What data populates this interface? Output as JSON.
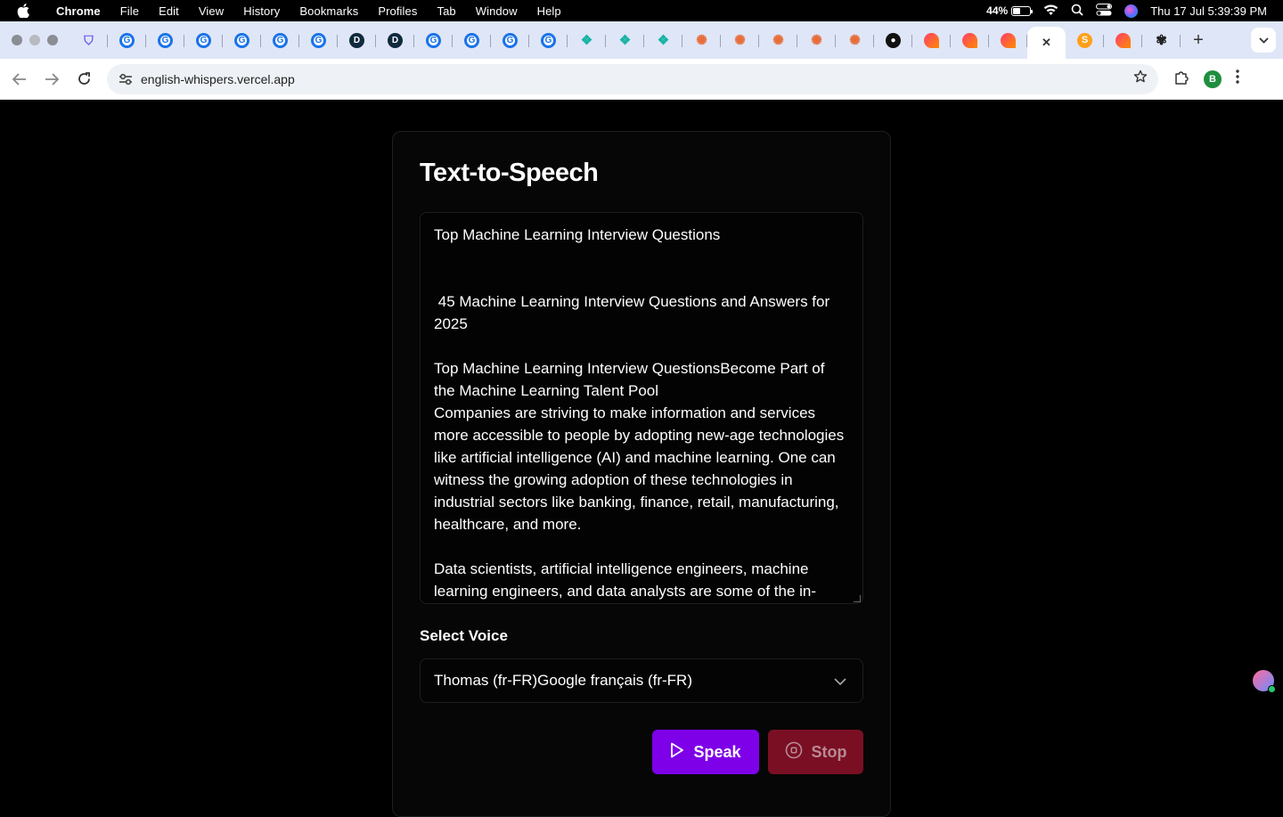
{
  "menubar": {
    "app": "Chrome",
    "items": [
      "File",
      "Edit",
      "View",
      "History",
      "Bookmarks",
      "Profiles",
      "Tab",
      "Window",
      "Help"
    ],
    "battery": "44%",
    "battery_level": 0.44,
    "datetime": "Thu 17 Jul  5:39:39 PM"
  },
  "tabs": [
    {
      "icon": "shield-icon",
      "kind": "sh",
      "glyph": "⛉"
    },
    {
      "icon": "google-icon",
      "kind": "g",
      "glyph": "G"
    },
    {
      "icon": "google-icon",
      "kind": "g",
      "glyph": "G"
    },
    {
      "icon": "google-icon",
      "kind": "g",
      "glyph": "G"
    },
    {
      "icon": "google-icon",
      "kind": "g",
      "glyph": "G"
    },
    {
      "icon": "google-icon",
      "kind": "g",
      "glyph": "G"
    },
    {
      "icon": "google-icon",
      "kind": "g",
      "glyph": "G"
    },
    {
      "icon": "d-icon",
      "kind": "d",
      "glyph": "D"
    },
    {
      "icon": "d-icon",
      "kind": "d",
      "glyph": "D"
    },
    {
      "icon": "google-icon",
      "kind": "g",
      "glyph": "G"
    },
    {
      "icon": "google-icon",
      "kind": "g",
      "glyph": "G"
    },
    {
      "icon": "google-icon",
      "kind": "g",
      "glyph": "G"
    },
    {
      "icon": "google-icon",
      "kind": "g",
      "glyph": "G"
    },
    {
      "icon": "teal-knot-icon",
      "kind": "t",
      "glyph": "❖"
    },
    {
      "icon": "teal-knot-icon",
      "kind": "t",
      "glyph": "❖"
    },
    {
      "icon": "teal-knot-icon",
      "kind": "t",
      "glyph": "❖"
    },
    {
      "icon": "claude-icon",
      "kind": "c",
      "glyph": "✺"
    },
    {
      "icon": "claude-icon",
      "kind": "c",
      "glyph": "✺"
    },
    {
      "icon": "claude-icon",
      "kind": "c",
      "glyph": "✺"
    },
    {
      "icon": "claude-icon",
      "kind": "c",
      "glyph": "✺"
    },
    {
      "icon": "claude-icon",
      "kind": "c",
      "glyph": "✺"
    },
    {
      "icon": "github-icon",
      "kind": "gh",
      "glyph": "●"
    },
    {
      "icon": "lovable-icon",
      "kind": "p",
      "glyph": ""
    },
    {
      "icon": "lovable-icon",
      "kind": "p",
      "glyph": ""
    },
    {
      "icon": "lovable-icon",
      "kind": "p",
      "glyph": ""
    },
    {
      "icon": "close-icon",
      "kind": "active",
      "glyph": "✕"
    },
    {
      "icon": "s-icon",
      "kind": "s",
      "glyph": "S"
    },
    {
      "icon": "lovable-icon",
      "kind": "p",
      "glyph": ""
    },
    {
      "icon": "openai-icon",
      "kind": "o",
      "glyph": "✾"
    }
  ],
  "toolbar": {
    "url": "english-whispers.vercel.app",
    "profile_initial": "B"
  },
  "app": {
    "title": "Text-to-Speech",
    "text": "Top Machine Learning Interview Questions\n\n\n 45 Machine Learning Interview Questions and Answers for 2025\n\nTop Machine Learning Interview QuestionsBecome Part of the Machine Learning Talent Pool\nCompanies are striving to make information and services more accessible to people by adopting new-age technologies like artificial intelligence (AI) and machine learning. One can witness the growing adoption of these technologies in industrial sectors like banking, finance, retail, manufacturing, healthcare, and more.\n\nData scientists, artificial intelligence engineers, machine learning engineers, and data analysts are some of the in-",
    "voice_label": "Select Voice",
    "voice_selected": "Thomas (fr-FR)Google français (fr-FR)",
    "speak_label": "Speak",
    "stop_label": "Stop"
  },
  "colors": {
    "speak": "#7e00e8",
    "stop": "#7a0f24"
  }
}
